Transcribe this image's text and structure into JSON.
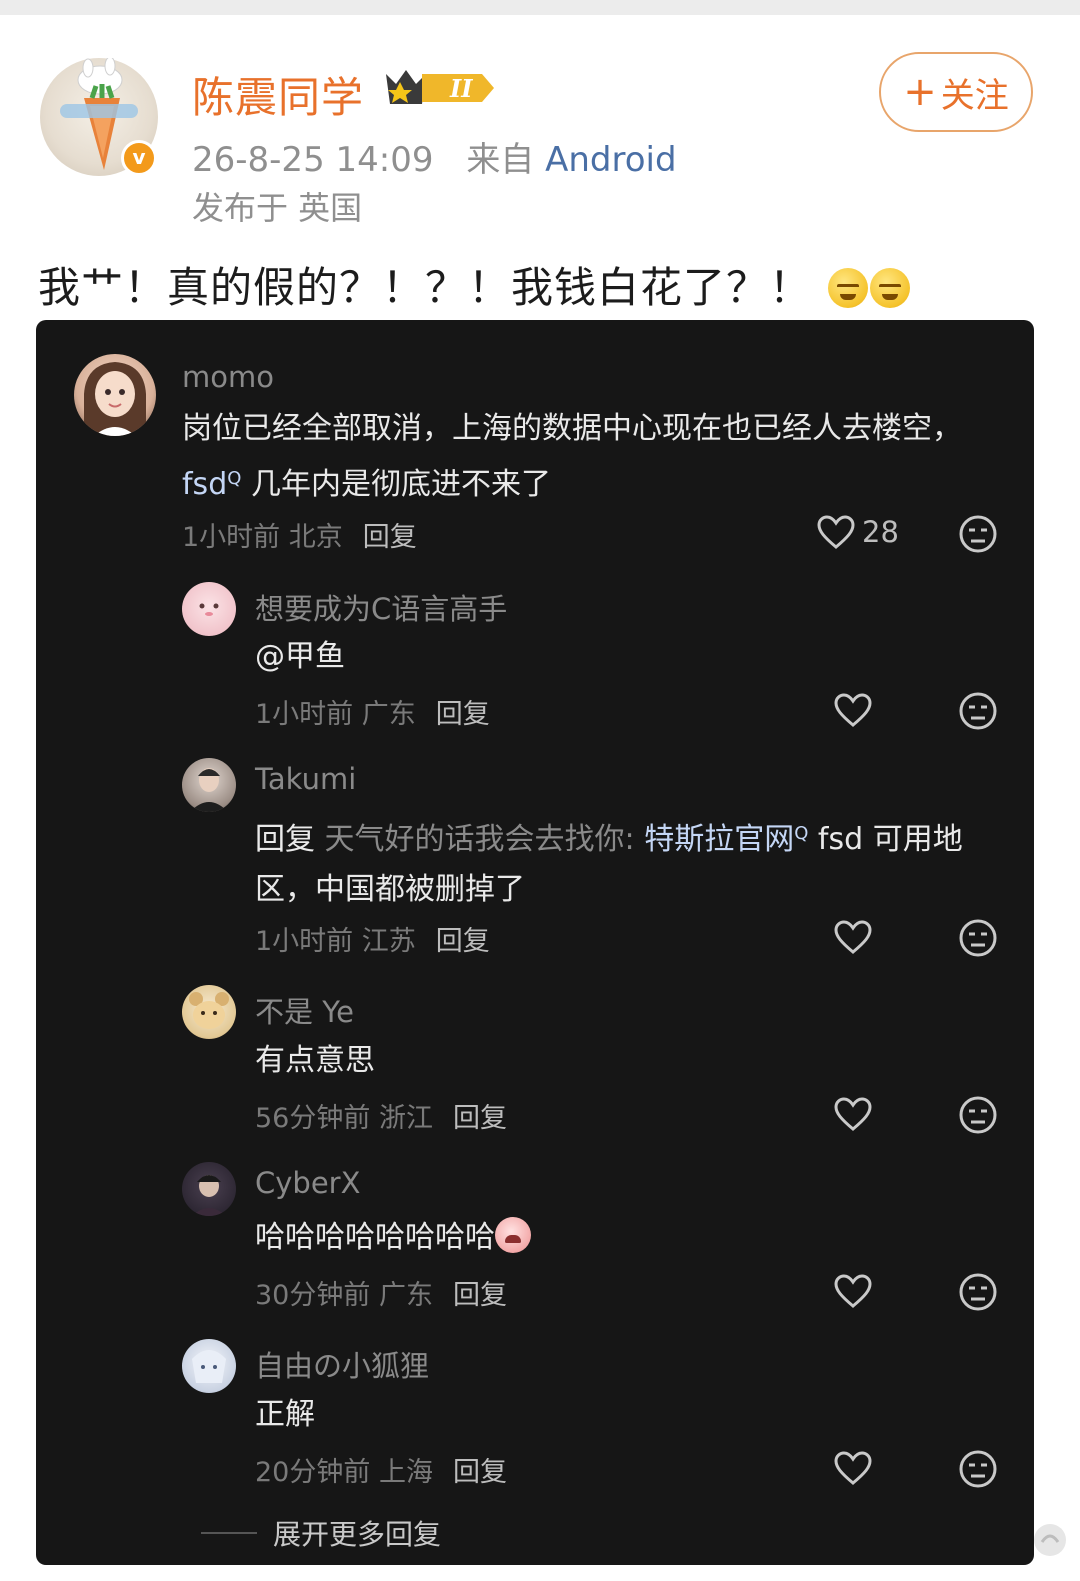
{
  "post": {
    "author": "陈震同学",
    "level_badge": "II",
    "verified_badge": "v",
    "date_time": "26-8-25 14:09",
    "via_prefix": "来自",
    "source": "Android",
    "location": "发布于 英国",
    "follow_plus": "+",
    "follow_label": "关注",
    "text": "我艹！真的假的？！？！我钱白花了？！",
    "text_emojis": [
      "dizzy-face-icon",
      "dizzy-face-icon"
    ]
  },
  "comments": [
    {
      "user": "momo",
      "text_plain": "岗位已经全部取消，上海的数据中心现在也已经人去楼空，",
      "text_link": "fsd",
      "text_after": "几年内是彻底进不来了",
      "time": "1小时前 北京",
      "reply": "回复",
      "likes": "28"
    },
    {
      "user": "想要成为C语言高手",
      "text": "@甲鱼",
      "time": "1小时前 广东",
      "reply": "回复"
    },
    {
      "user": "Takumi",
      "text_prefix": "回复",
      "text_target": "天气好的话我会去找你:",
      "text_link": "特斯拉官网",
      "text_after_1": "fsd 可用地",
      "text_after_2": "区，中国都被删掉了",
      "time": "1小时前 江苏",
      "reply": "回复"
    },
    {
      "user": "不是 Ye",
      "text": "有点意思",
      "time": "56分钟前 浙江",
      "reply": "回复"
    },
    {
      "user": "CyberX",
      "text": "哈哈哈哈哈哈哈哈",
      "time": "30分钟前 广东",
      "reply": "回复"
    },
    {
      "user": "自由の小狐狸",
      "text": "正解",
      "time": "20分钟前 上海",
      "reply": "回复"
    }
  ],
  "expand_more": "展开更多回复",
  "colors": {
    "accent_orange": "#e8712b",
    "source_blue": "#4a6fa5",
    "dark_bg": "#161616"
  }
}
